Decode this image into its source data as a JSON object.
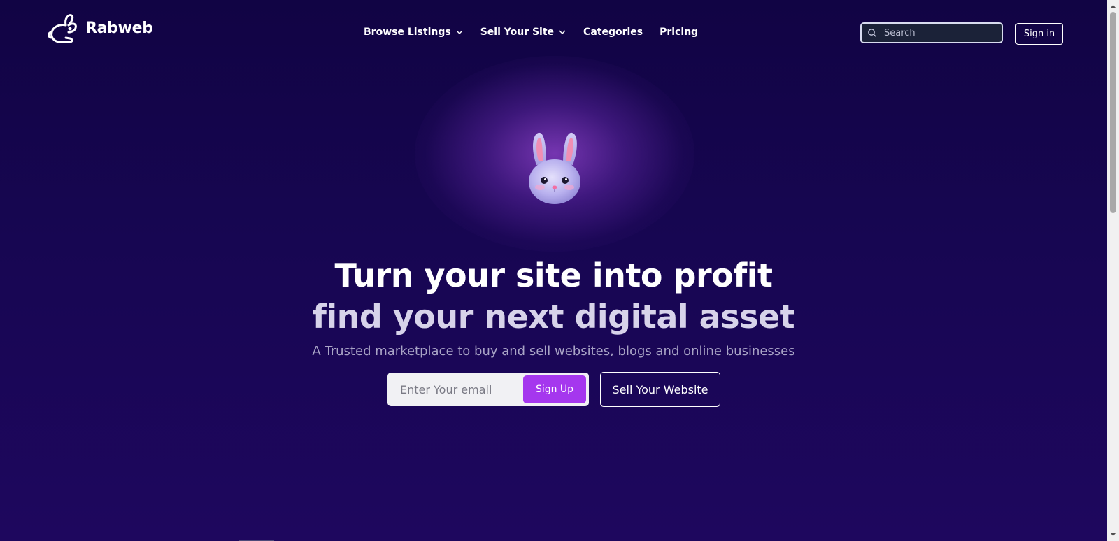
{
  "brand": {
    "name": "Rabweb",
    "logo_icon": "rabbit-logo-icon"
  },
  "nav": {
    "items": [
      {
        "label": "Browse Listings",
        "has_dropdown": true
      },
      {
        "label": "Sell Your Site",
        "has_dropdown": true
      },
      {
        "label": "Categories",
        "has_dropdown": false
      },
      {
        "label": "Pricing",
        "has_dropdown": false
      }
    ]
  },
  "search": {
    "placeholder": "Search",
    "value": "",
    "icon": "search-icon"
  },
  "auth": {
    "signin_label": "Sign in"
  },
  "hero": {
    "mascot": "bunny-face-icon",
    "headline_line1": "Turn your site into profit",
    "headline_line2": "find your next digital asset",
    "subtitle": "A Trusted marketplace to buy and sell websites, blogs and online businesses",
    "email_placeholder": "Enter Your email",
    "email_value": "",
    "signup_label": "Sign Up",
    "sell_label": "Sell Your Website"
  },
  "colors": {
    "background_top": "#110444",
    "background_bottom": "#1e075e",
    "accent": "#a537ee",
    "glow": "#9646d2",
    "subtitle_text": "#a9a4c6"
  }
}
